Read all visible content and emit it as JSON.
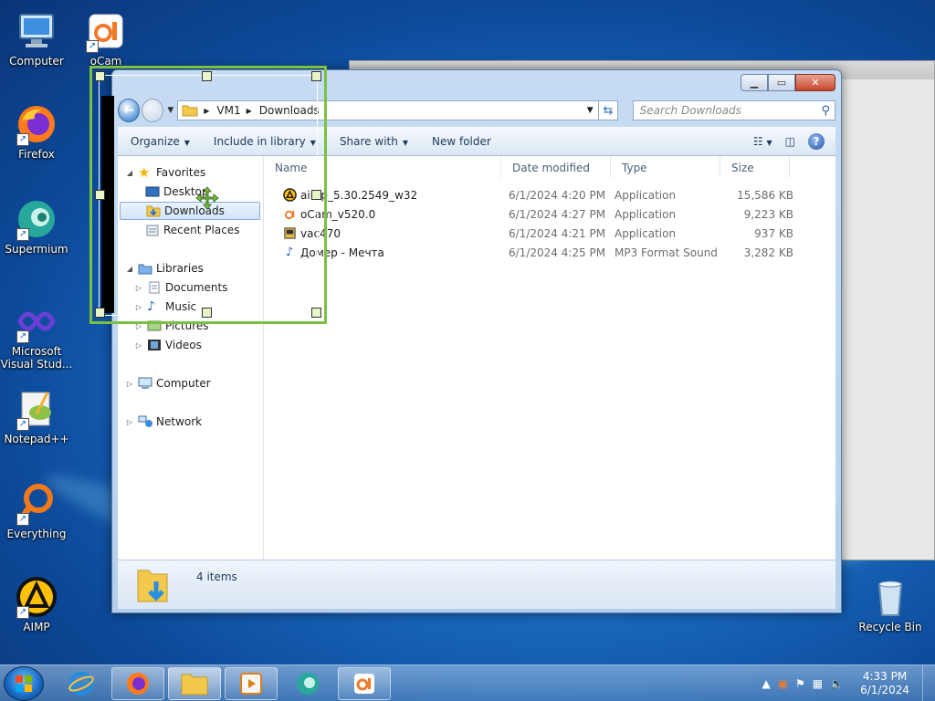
{
  "desktop": {
    "icons": [
      {
        "label": "Computer"
      },
      {
        "label": "oCam"
      },
      {
        "label": "Firefox"
      },
      {
        "label": "Supermium"
      },
      {
        "label": "Microsoft Visual Stud..."
      },
      {
        "label": "Notepad++"
      },
      {
        "label": "Everything"
      },
      {
        "label": "AIMP"
      },
      {
        "label": "Recycle Bin"
      }
    ]
  },
  "explorer": {
    "breadcrumb": [
      "VM1",
      "Downloads"
    ],
    "search_placeholder": "Search Downloads",
    "toolbar": {
      "organize": "Organize",
      "include_in_library": "Include in library",
      "share_with": "Share with",
      "new_folder": "New folder"
    },
    "nav": {
      "favorites": "Favorites",
      "desktop": "Desktop",
      "downloads": "Downloads",
      "recent_places": "Recent Places",
      "libraries": "Libraries",
      "documents": "Documents",
      "music": "Music",
      "pictures": "Pictures",
      "videos": "Videos",
      "computer": "Computer",
      "network": "Network"
    },
    "columns": {
      "name": "Name",
      "date_modified": "Date modified",
      "type": "Type",
      "size": "Size"
    },
    "files": [
      {
        "name": "aimp_5.30.2549_w32",
        "date": "6/1/2024 4:20 PM",
        "type": "Application",
        "size": "15,586 KB"
      },
      {
        "name": "oCam_v520.0",
        "date": "6/1/2024 4:27 PM",
        "type": "Application",
        "size": "9,223 KB"
      },
      {
        "name": "vac470",
        "date": "6/1/2024 4:21 PM",
        "type": "Application",
        "size": "937 KB"
      },
      {
        "name": "Домер - Мечта",
        "date": "6/1/2024 4:25 PM",
        "type": "MP3 Format Sound",
        "size": "3,282 KB"
      }
    ],
    "status": {
      "item_count": "4 items"
    }
  },
  "taskbar": {
    "clock_time": "4:33 PM",
    "clock_date": "6/1/2024"
  }
}
